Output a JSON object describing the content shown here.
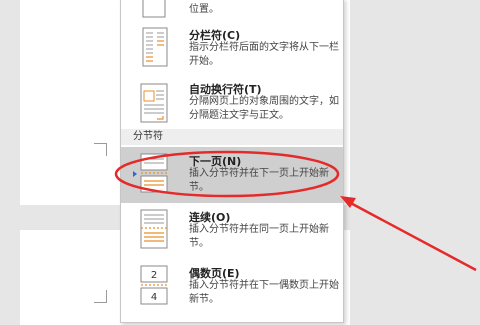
{
  "menu": {
    "top_partial": {
      "desc": "位置。"
    },
    "column_break": {
      "title": "分栏符(C)",
      "desc": "指示分栏符后面的文字将从下一栏开始。"
    },
    "text_wrap_break": {
      "title": "自动换行符(T)",
      "desc": "分隔网页上的对象周围的文字，如分隔题注文字与正文。"
    },
    "section_header": "分节符",
    "next_page": {
      "title": "下一页(N)",
      "desc": "插入分节符并在下一页上开始新节。"
    },
    "continuous": {
      "title": "连续(O)",
      "desc": "插入分节符并在同一页上开始新节。"
    },
    "even_page": {
      "title": "偶数页(E)",
      "desc": "插入分节符并在下一偶数页上开始新节。",
      "icon_numbers": [
        "2",
        "4"
      ]
    }
  },
  "colors": {
    "annotation": "#e52a2a",
    "hover": "#cfcfcf",
    "accent": "#e8902c"
  }
}
